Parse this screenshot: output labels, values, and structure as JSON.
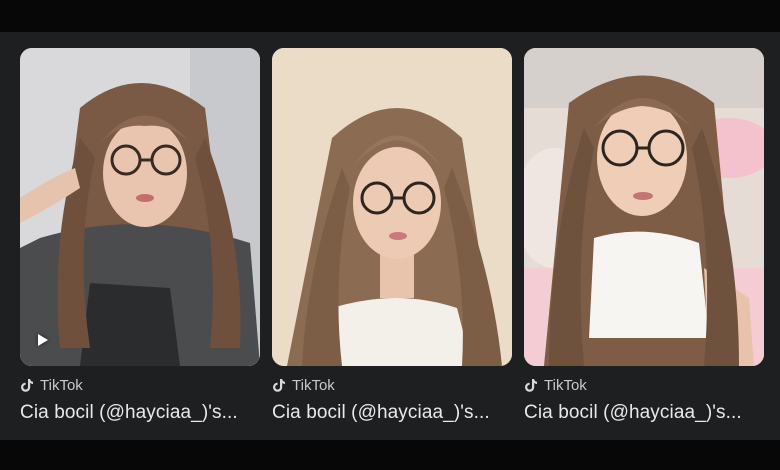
{
  "results": [
    {
      "source": "TikTok",
      "source_icon": "tiktok-icon",
      "title": "Cia bocil (@hayciaa_)'s...",
      "has_play_icon": true
    },
    {
      "source": "TikTok",
      "source_icon": "tiktok-icon",
      "title": "Cia bocil (@hayciaa_)'s...",
      "has_play_icon": false
    },
    {
      "source": "TikTok",
      "source_icon": "tiktok-icon",
      "title": "Cia bocil (@hayciaa_)'s...",
      "has_play_icon": false
    }
  ],
  "colors": {
    "page_background": "#0b0b0c",
    "panel_background": "#1e1f21",
    "source_text": "#c9c9c9",
    "title_text": "#e9e9e9"
  }
}
